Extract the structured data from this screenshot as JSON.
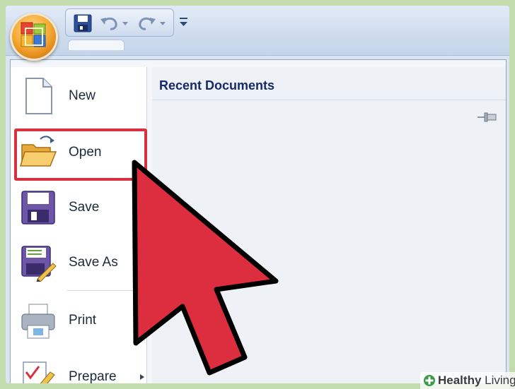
{
  "toolbar": {
    "save_icon": "save-icon",
    "undo_icon": "undo-icon",
    "redo_icon": "redo-icon",
    "customize_icon": "customize-qat-icon"
  },
  "office_button": {
    "icon": "office-logo-icon"
  },
  "menu": {
    "items": [
      {
        "label": "New",
        "icon": "new-document-icon"
      },
      {
        "label": "Open",
        "icon": "open-folder-icon"
      },
      {
        "label": "Save",
        "icon": "save-icon"
      },
      {
        "label": "Save As",
        "icon": "save-as-icon"
      },
      {
        "label": "Print",
        "icon": "printer-icon"
      },
      {
        "label": "Prepare",
        "icon": "prepare-icon"
      }
    ],
    "highlighted_item": "Open"
  },
  "recent": {
    "header": "Recent Documents",
    "pin_icon": "pin-icon"
  },
  "overlay": {
    "cursor_icon": "red-arrow-cursor-icon",
    "cursor_color": "#dc2e3e"
  },
  "watermark": {
    "prefix": "Healthy",
    "suffix": " Living"
  }
}
